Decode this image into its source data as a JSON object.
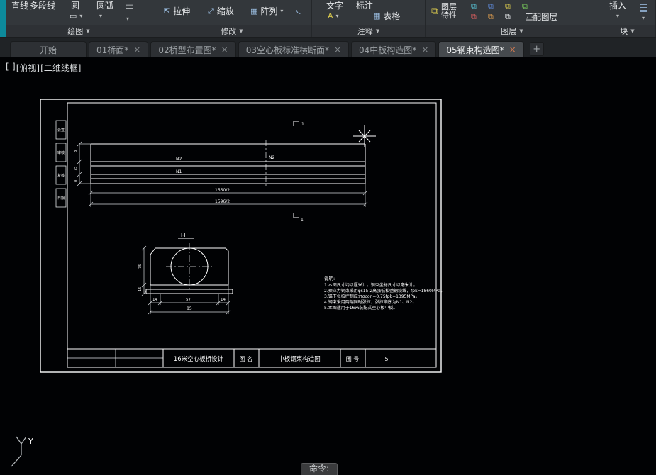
{
  "icons": {
    "dropdown_small": "▾",
    "dropdown_panel": "▼",
    "rect_tool": "▭",
    "arc_tool": "⌒",
    "stretch_tool": "⇱",
    "scale_tool": "⤢",
    "array_tool": "▦",
    "fillet_tool": "◟",
    "table_tool": "▦",
    "text_tool": "A",
    "layer_stack": "⧉",
    "insert_block": "▤",
    "close": "×",
    "new_tab": "+"
  },
  "ribbon": {
    "draw": {
      "panel_label": "绘图",
      "line": "直线",
      "polyline": "多段线",
      "circle": "圆",
      "arc": "圆弧"
    },
    "modify": {
      "panel_label": "修改",
      "stretch": "拉伸",
      "scale": "缩放",
      "array": "阵列"
    },
    "annotate": {
      "panel_label": "注释",
      "text": "文字",
      "dimension": "标注",
      "table": "表格"
    },
    "layers": {
      "panel_label": "图层",
      "properties_line1": "图层",
      "properties_line2": "特性",
      "match": "匹配图层"
    },
    "block": {
      "panel_label": "块",
      "insert": "插入"
    }
  },
  "tabs": {
    "items": [
      {
        "label": "开始"
      },
      {
        "label": "01桥面*"
      },
      {
        "label": "02桥型布置图*"
      },
      {
        "label": "03空心板标准横断面*"
      },
      {
        "label": "04中板构造图*"
      },
      {
        "label": "05钢束构造图*"
      }
    ]
  },
  "viewport": {
    "minus": "[-]",
    "view": "[俯视]",
    "style": "[二维线框]"
  },
  "drawing": {
    "margin_boxes": [
      "会签",
      "审核",
      "复核",
      "日期"
    ],
    "elevation": {
      "tendon_upper": "N2",
      "tendon_lower": "N1",
      "dim_half_span": "1550/2",
      "dim_half_length": "1596/2",
      "left_dims": [
        "8",
        "75",
        "8"
      ]
    },
    "section_mark": "1",
    "section": {
      "title": "I-I",
      "dim_left": "75",
      "dim_left2": "15",
      "dims_bottom": [
        "14",
        "57",
        "14"
      ],
      "dim_total": "85"
    },
    "notes": {
      "title": "说明:",
      "lines": [
        "1.本图尺寸均以厘米计，钢束坐标尺寸以毫米计。",
        "2.预应力钢束采用φs15.2高强低松弛钢绞线，fpk=1860MPa。",
        "3.锚下张拉控制应力σcon=0.75fpk=1395MPa。",
        "4.钢束采用两端同时张拉，张拉顺序为N1、N2。",
        "5.本图适用于16米装配式空心板中板。"
      ]
    },
    "titleblock": {
      "project": "16米空心板桥设计",
      "name_label": "图 名",
      "drawing_name": "中板钢束构造图",
      "no_label": "图 号",
      "no": "5"
    }
  },
  "command": {
    "prompt": "命令:"
  },
  "ucs": {
    "y_label": "Y"
  }
}
